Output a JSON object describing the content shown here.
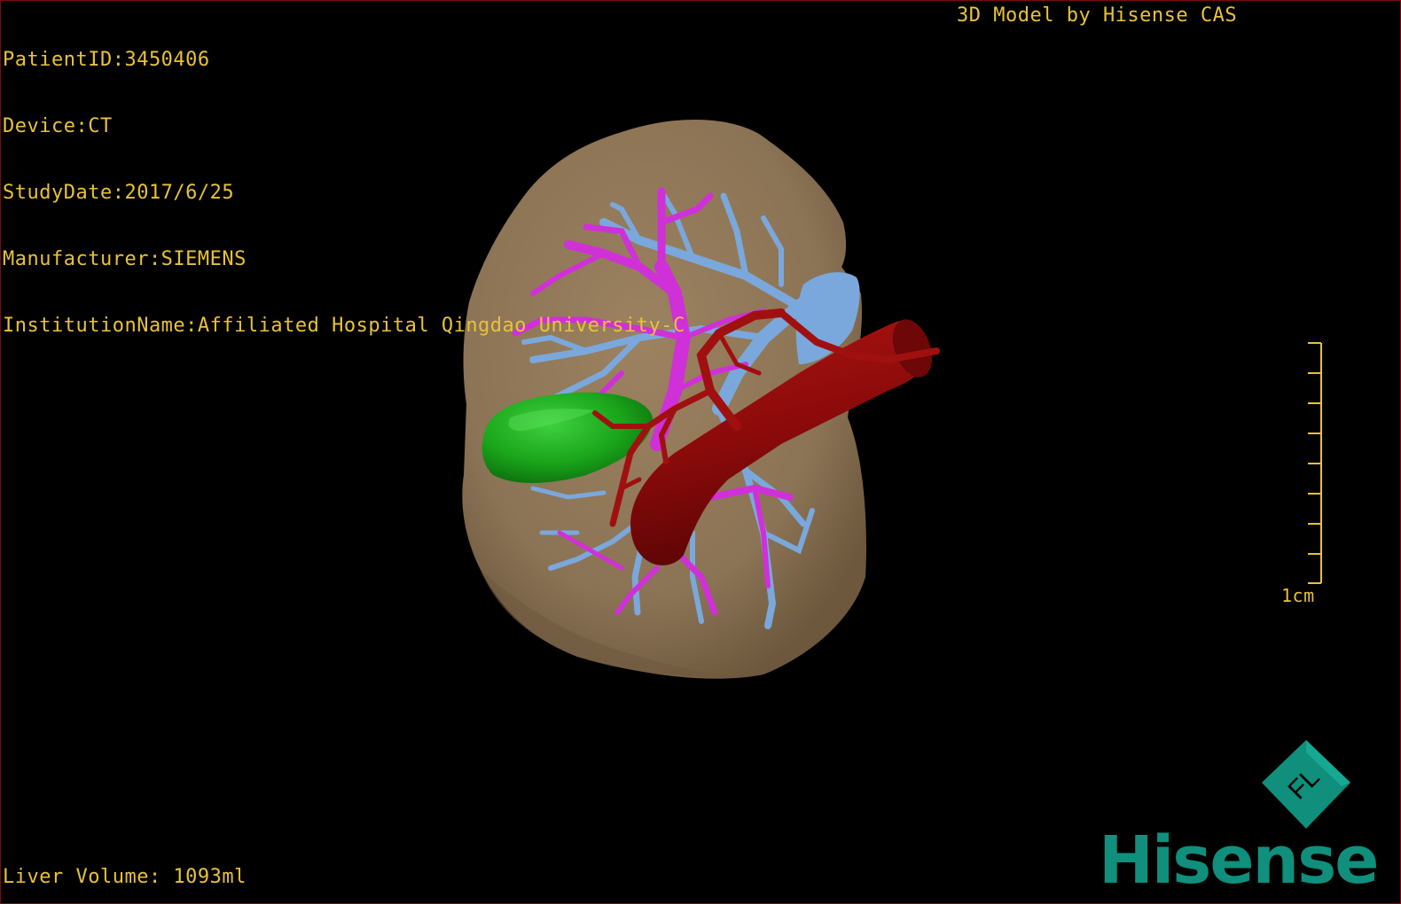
{
  "overlay": {
    "patient_id": "PatientID:3450406",
    "device": "Device:CT",
    "study_date": "StudyDate:2017/6/25",
    "manufacturer": "Manufacturer:SIEMENS",
    "institution": "InstitutionName:Affiliated Hospital Qingdao University-C",
    "model_credit": "3D Model by Hisense CAS",
    "liver_volume": "Liver Volume: 1093ml"
  },
  "scale": {
    "label": "1cm"
  },
  "logo": {
    "text": "Hisense",
    "icon_letters": "FL"
  },
  "colors": {
    "overlay_text": "#e8c23a",
    "liver": "#8b7355",
    "portal_vein": "#7aa8dc",
    "hepatic_vein": "#d030d8",
    "aorta": "#8b0a0a",
    "gallbladder": "#1aa51a",
    "logo_teal": "#0f8f7c"
  },
  "icons": [
    "fl-orientation-cube-icon"
  ]
}
